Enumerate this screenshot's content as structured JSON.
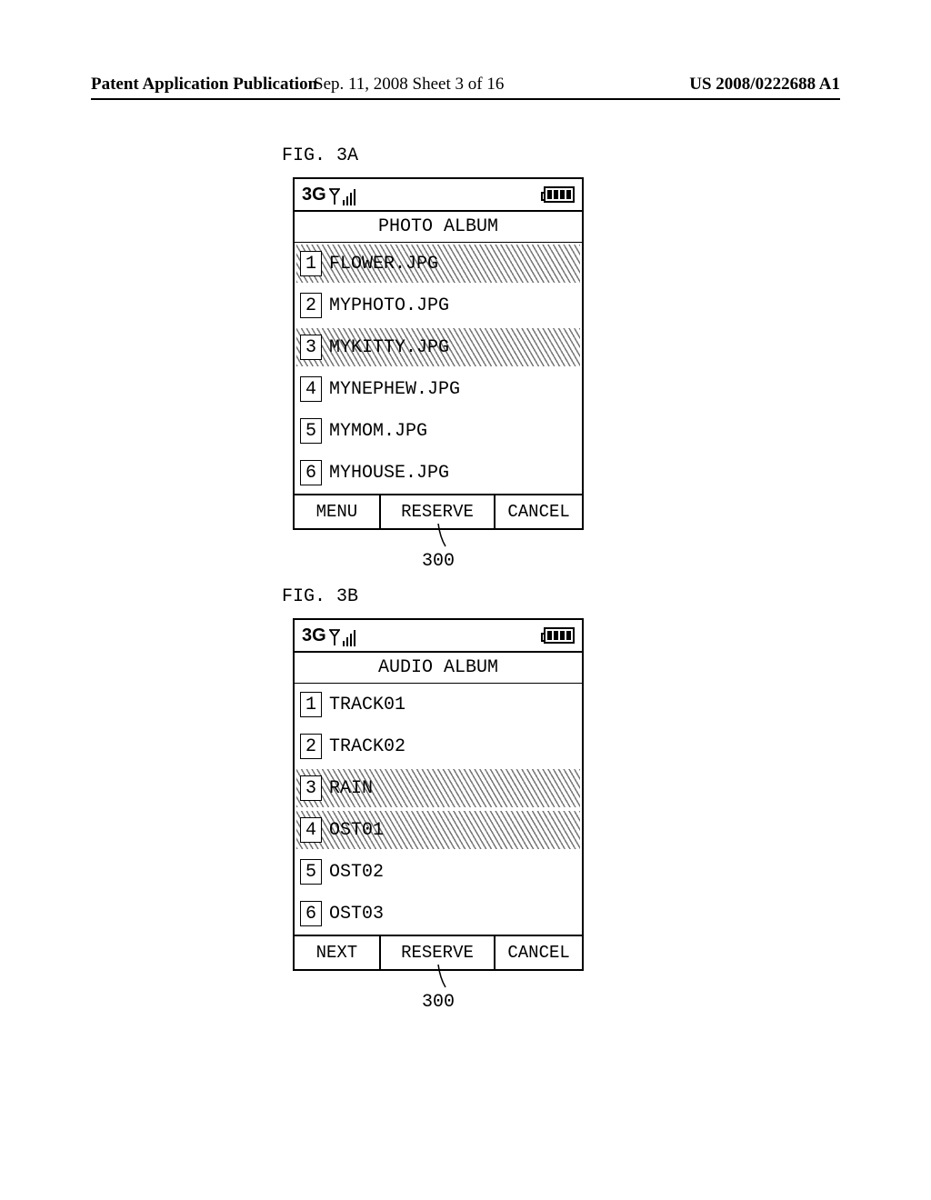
{
  "header": {
    "left": "Patent Application Publication",
    "center": "Sep. 11, 2008  Sheet 3 of 16",
    "right": "US 2008/0222688 A1"
  },
  "figA": {
    "label": "FIG. 3A",
    "network": "3G",
    "title": "PHOTO ALBUM",
    "items": [
      {
        "num": "1",
        "name": "FLOWER.JPG",
        "selected": true
      },
      {
        "num": "2",
        "name": "MYPHOTO.JPG",
        "selected": false
      },
      {
        "num": "3",
        "name": "MYKITTY.JPG",
        "selected": true
      },
      {
        "num": "4",
        "name": "MYNEPHEW.JPG",
        "selected": false
      },
      {
        "num": "5",
        "name": "MYMOM.JPG",
        "selected": false
      },
      {
        "num": "6",
        "name": "MYHOUSE.JPG",
        "selected": false
      }
    ],
    "softkeys": {
      "left": "MENU",
      "mid": "RESERVE",
      "right": "CANCEL"
    },
    "callout": "300"
  },
  "figB": {
    "label": "FIG. 3B",
    "network": "3G",
    "title": "AUDIO ALBUM",
    "items": [
      {
        "num": "1",
        "name": "TRACK01",
        "selected": false
      },
      {
        "num": "2",
        "name": "TRACK02",
        "selected": false
      },
      {
        "num": "3",
        "name": "RAIN",
        "selected": true
      },
      {
        "num": "4",
        "name": "OST01",
        "selected": true
      },
      {
        "num": "5",
        "name": "OST02",
        "selected": false
      },
      {
        "num": "6",
        "name": "OST03",
        "selected": false
      }
    ],
    "softkeys": {
      "left": "NEXT",
      "mid": "RESERVE",
      "right": "CANCEL"
    },
    "callout": "300"
  }
}
